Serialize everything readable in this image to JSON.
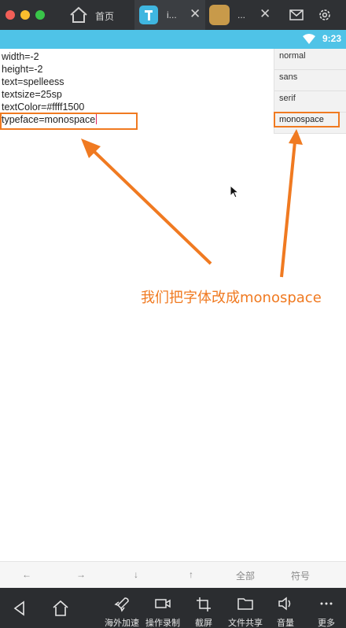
{
  "tabs": {
    "home_label": "首页",
    "app1_label": "i...",
    "app2_label": "..."
  },
  "status": {
    "time": "9:23"
  },
  "properties": {
    "width": "width=-2",
    "height": "height=-2",
    "text": "text=spelleess",
    "textsize": "textsize=25sp",
    "textColor": "textColor=#ffff1500",
    "typeface": "typeface=monospace"
  },
  "font_options": [
    "normal",
    "sans",
    "serif",
    "monospace"
  ],
  "annotation": "我们把字体改成monospace",
  "key_row": {
    "left": "←",
    "right": "→",
    "down": "↓",
    "up": "↑",
    "all": "全部",
    "symbol": "符号"
  },
  "toolbar": {
    "accelerate": "海外加速",
    "record": "操作录制",
    "screenshot": "截屏",
    "file_share": "文件共享",
    "volume": "音量",
    "more": "更多"
  },
  "colors": {
    "accent": "#f07a21",
    "status_bar": "#4fc3e7",
    "tab_bar": "#2f3134",
    "toolbar": "#2b2d30"
  }
}
